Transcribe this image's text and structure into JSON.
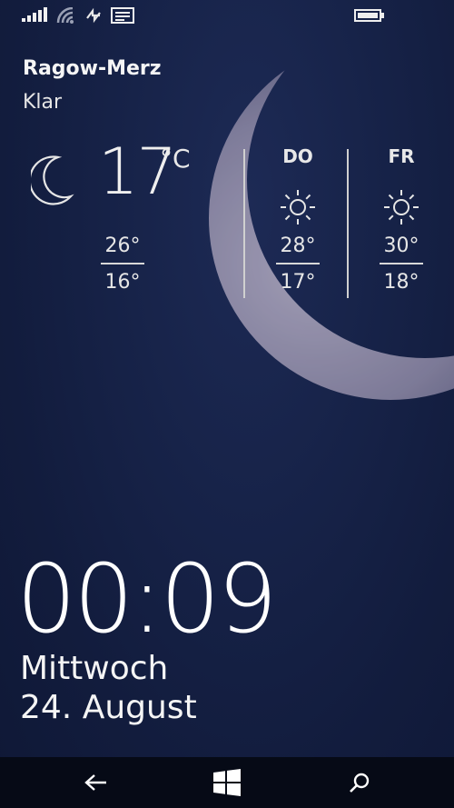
{
  "status_bar": {
    "icons": [
      "signal-strength-icon",
      "wifi-icon",
      "data-transfer-icon",
      "message-icon",
      "battery-icon"
    ]
  },
  "weather": {
    "location": "Ragow-Merz",
    "condition": "Klar",
    "current": {
      "icon": "crescent-moon-icon",
      "temperature": "17",
      "unit": "°C",
      "high": "26°",
      "low": "16°"
    },
    "forecast": [
      {
        "day": "DO",
        "icon": "sun-icon",
        "high": "28°",
        "low": "17°"
      },
      {
        "day": "FR",
        "icon": "sun-icon",
        "high": "30°",
        "low": "18°"
      }
    ]
  },
  "lockscreen": {
    "time": "00:09",
    "weekday": "Mittwoch",
    "date": "24. August"
  },
  "nav_bar": {
    "buttons": [
      "back-arrow-icon",
      "windows-start-icon",
      "search-icon"
    ]
  },
  "colors": {
    "background": "#152044",
    "text": "#f2f2f2",
    "nav_bar": "#060a16"
  }
}
